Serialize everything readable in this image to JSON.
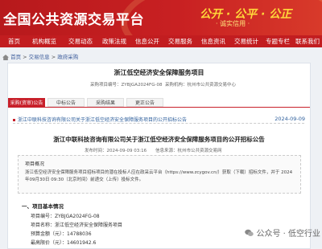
{
  "header": {
    "logo": "全国公共资源交易平台",
    "slogan": "公开 · 公平 · 公正",
    "slogan_sub": "· 诚实信用 ·"
  },
  "nav": [
    "首页",
    "机构概览",
    "交易动态",
    "政策法规",
    "信息公开",
    "交易服务",
    "信息资讯",
    "交易统计",
    "专题专栏",
    "联系我们"
  ],
  "breadcrumb": {
    "items": [
      "首页",
      "交易信息",
      "政府采购"
    ]
  },
  "project": {
    "title": "浙江低空经济安全保障服务项目",
    "code_label": "采购项目编号：",
    "code": "ZYBJGA2024FG-08",
    "agency_label": "采购机构：",
    "agency": "杭州市公共资源交易中心"
  },
  "tabs": [
    "采购(资审)公告",
    "中标公告",
    "采购结果",
    "更正公告"
  ],
  "notice": {
    "link": "浙江中联科技咨询有限公司关于浙江低空经济安全保障服务项目的公开招标公告",
    "date": "2024-09-09"
  },
  "article": {
    "title": "浙江中联科技咨询有限公司关于浙江低空经济安全保障服务项目的公开招标公告",
    "time": "发布时间：2024-09-09 03:16",
    "source": "信息来源：杭州市公共资源交易网"
  },
  "overview": {
    "heading": "项目概况",
    "body": "浙江低空经济安全保障服务项目招标项目的潜在投标人应在政采云平台（https://www.zcygov.cn/）获取（下载）招标文件，并于 2024年09月30日 09:30（北京时间）前递交（上传）投标文件。"
  },
  "section": {
    "heading": "一、项目基本情况",
    "rows": [
      "项目编号：ZYBJGA2024FG-08",
      "项目名称：浙江低空经济安全保障服务项目",
      "预算金额（元）：14788036",
      "最高限价（元）：14601942.6"
    ]
  },
  "watermark": "公众号 · 低空行业"
}
